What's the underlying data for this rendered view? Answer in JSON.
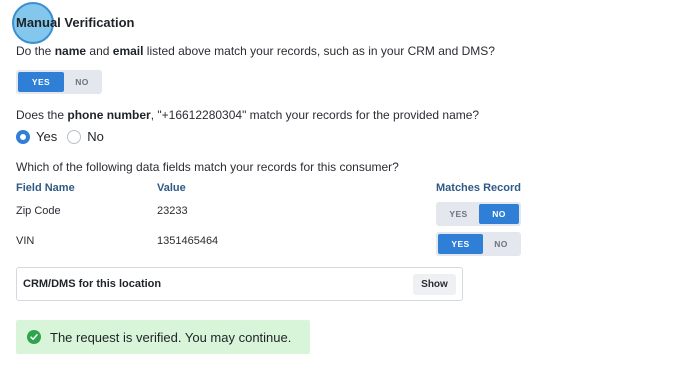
{
  "section": {
    "title_a": "Manual",
    "title_b": " Verification"
  },
  "q1": {
    "prefix": "Do the ",
    "name_word": "name",
    "mid": " and ",
    "email_word": "email",
    "suffix": " listed above match your records, such as in your CRM and DMS?",
    "yes": "YES",
    "no": "NO",
    "selected": "YES"
  },
  "q2": {
    "prefix": "Does the ",
    "phone_word": "phone number",
    "suffix": ", \"+16612280304\" match your records for the provided name?",
    "yes": "Yes",
    "no": "No",
    "selected": "Yes"
  },
  "q3": {
    "text": "Which of the following data fields match your records for this consumer?",
    "headers": [
      "Field Name",
      "Value",
      "Matches Record"
    ],
    "rows": [
      {
        "field": "Zip Code",
        "value": "23233",
        "yes": "YES",
        "no": "NO",
        "selected": "NO"
      },
      {
        "field": "VIN",
        "value": "1351465464",
        "yes": "YES",
        "no": "NO",
        "selected": "YES"
      }
    ]
  },
  "crm": {
    "label": "CRM/DMS for this location",
    "button": "Show"
  },
  "alert": {
    "text": "The request is verified. You may continue.",
    "color": "#2ea44f"
  },
  "colors": {
    "accent": "#2f7fd6",
    "header_text": "#2f5a86",
    "success_bg": "#d9f5d9"
  }
}
